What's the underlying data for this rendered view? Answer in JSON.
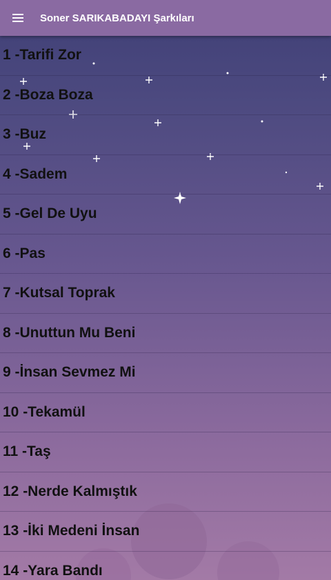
{
  "app_bar": {
    "title": "Soner SARIKABADAYI Şarkıları",
    "menu_icon": "hamburger-menu-icon",
    "color": "#8a6aa2"
  },
  "songs": [
    "1 -Tarifi Zor",
    "2 -Boza Boza",
    "3 -Buz",
    "4 -Sadem",
    "5 -Gel De Uyu",
    "6 -Pas",
    "7 -Kutsal Toprak",
    "8 -Unuttun Mu Beni",
    "9 -İnsan Sevmez Mi",
    "10 -Tekamül",
    "11 -Taş",
    "12 -Nerde Kalmıştık",
    "13 -İki Medeni İnsan",
    "14 -Yara Bandı"
  ]
}
